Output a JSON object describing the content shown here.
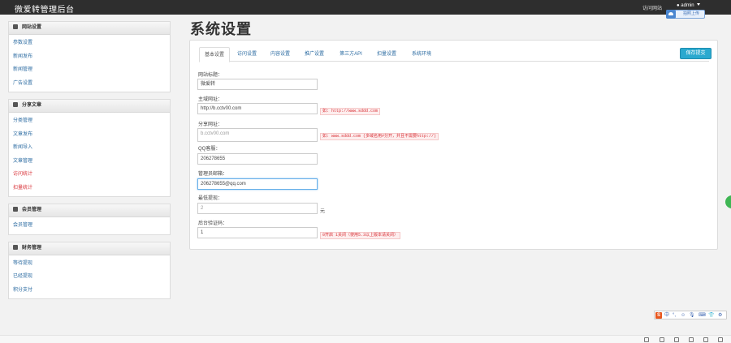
{
  "header": {
    "brand": "微爱转管理后台",
    "visit_site": "访问网站",
    "user": "admin",
    "upload_label": "拍照上传"
  },
  "sidebar": {
    "panels": [
      {
        "title": "网站设置",
        "items": [
          {
            "label": "参数设置",
            "color": "blue"
          },
          {
            "label": "新闻发布",
            "color": "blue"
          },
          {
            "label": "新闻管理",
            "color": "blue"
          },
          {
            "label": "广告设置",
            "color": "blue"
          }
        ]
      },
      {
        "title": "分享文章",
        "items": [
          {
            "label": "分类管理",
            "color": "blue"
          },
          {
            "label": "文章发布",
            "color": "blue"
          },
          {
            "label": "新闻导入",
            "color": "blue"
          },
          {
            "label": "文章管理",
            "color": "blue"
          },
          {
            "label": "访问统计",
            "color": "red"
          },
          {
            "label": "扣量统计",
            "color": "red"
          }
        ]
      },
      {
        "title": "会员管理",
        "items": [
          {
            "label": "会员管理",
            "color": "blue"
          }
        ]
      },
      {
        "title": "财务管理",
        "items": [
          {
            "label": "等待提现",
            "color": "blue"
          },
          {
            "label": "已经提现",
            "color": "blue"
          },
          {
            "label": "积分支付",
            "color": "blue"
          }
        ]
      }
    ]
  },
  "main": {
    "title": "系统设置",
    "save_label": "保存提交",
    "tabs": [
      {
        "label": "基本设置",
        "active": true
      },
      {
        "label": "访问设置",
        "active": false
      },
      {
        "label": "内容设置",
        "active": false
      },
      {
        "label": "推广设置",
        "active": false
      },
      {
        "label": "第三方API",
        "active": false
      },
      {
        "label": "扣量设置",
        "active": false
      },
      {
        "label": "系统环境",
        "active": false
      }
    ],
    "fields": {
      "site_title": {
        "label": "网站标题：",
        "value": "微爱转"
      },
      "main_domain": {
        "label": "主域网址：",
        "value": "http://b.cctv00.com",
        "hint": "如: http://www.sddd.com"
      },
      "share_domain": {
        "label": "分享网址：",
        "placeholder": "b.cctv00.com",
        "hint": "如: www.sddd.com (多域名用#分开，并且不需要http://)"
      },
      "qq": {
        "label": "QQ客服：",
        "value": "206278655"
      },
      "email": {
        "label": "管理员邮箱：",
        "value": "206278655@qq.com"
      },
      "min_withdraw": {
        "label": "最低提现：",
        "placeholder": "2",
        "unit": "元"
      },
      "backend_verify": {
        "label": "后台验证码：",
        "value": "1",
        "hint": "0开启 1关闭（使用5.3以上版本请关闭）"
      }
    }
  },
  "ime": {
    "logo": "S",
    "items": [
      "中",
      "°,",
      "☺",
      "🎙",
      "⌨",
      "👕",
      "⚙"
    ]
  },
  "colors": {
    "topbar": "#2e2e2e",
    "link_blue": "#2d6ca2",
    "link_red": "#d9343a",
    "save_button": "#2aa9cf"
  }
}
